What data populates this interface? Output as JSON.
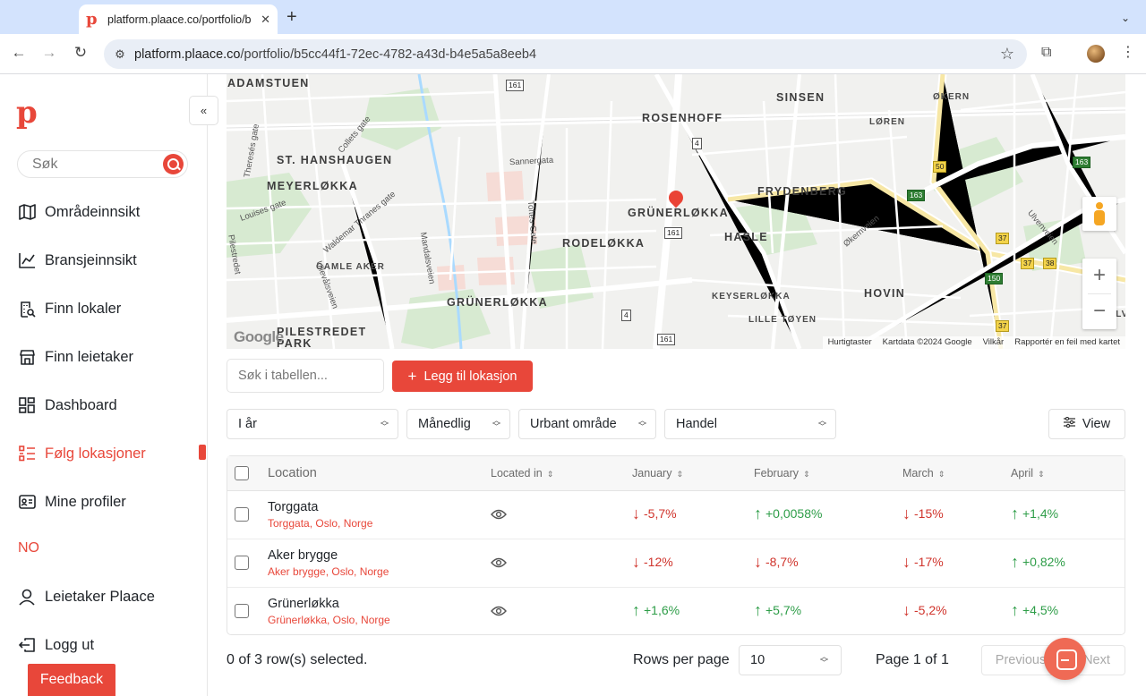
{
  "browser": {
    "tab_title": "platform.plaace.co/portfolio/b",
    "favicon": "p",
    "url_host": "platform.plaace.co",
    "url_path": "/portfolio/b5cc44f1-72ec-4782-a43d-b4e5a5a8eeb4"
  },
  "sidebar": {
    "logo": "p",
    "collapse_icon": "«",
    "search_placeholder": "Søk",
    "items": [
      {
        "label": "Områdeinnsikt",
        "icon": "map-icon"
      },
      {
        "label": "Bransjeinnsikt",
        "icon": "line-chart-icon"
      },
      {
        "label": "Finn lokaler",
        "icon": "building-search-icon"
      },
      {
        "label": "Finn leietaker",
        "icon": "store-icon"
      },
      {
        "label": "Dashboard",
        "icon": "dashboard-grid-icon"
      },
      {
        "label": "Følg lokasjoner",
        "icon": "list-icon",
        "active": true
      },
      {
        "label": "Mine profiler",
        "icon": "id-card-icon"
      }
    ],
    "language": "NO",
    "user_label": "Leietaker Plaace",
    "logout_label": "Logg ut",
    "feedback_label": "Feedback"
  },
  "map": {
    "areas": [
      "ADAMSTUEN",
      "ST. HANSHAUGEN",
      "MEYERLØKKA",
      "GAMLE AKER",
      "PILESTREDET PARK",
      "GRÜNERLØKKA",
      "RODELØKKA",
      "GRÜNERLØKKA",
      "ROSENHOFF",
      "SINSEN",
      "FRYDENBERG",
      "HASLE",
      "HOVIN",
      "LILLE TØYEN",
      "ØKERN",
      "LØREN",
      "KEYSERLØKKA",
      "ULV"
    ],
    "streets": [
      "Collets gate",
      "Theresés gate",
      "Louises gate",
      "Waldemar Thranes gate",
      "Sannergata",
      "Toftes Gate",
      "Mandalsveien",
      "Ullevålsveien",
      "Pilestredet",
      "Økernveien",
      "Ulvenveien"
    ],
    "route_shields": [
      "161",
      "4",
      "161",
      "4",
      "161",
      "50",
      "163",
      "163",
      "37",
      "37",
      "38",
      "150",
      "37"
    ],
    "attribution": [
      "Hurtigtaster",
      "Kartdata ©2024 Google",
      "Vilkår",
      "Rapportér en feil med kartet"
    ],
    "google_logo": "Google",
    "zoom_in": "+",
    "zoom_out": "−"
  },
  "controls": {
    "table_search_placeholder": "Søk i tabellen...",
    "add_button": "Legg til lokasjon",
    "filters": [
      "I år",
      "Månedlig",
      "Urbant område",
      "Handel"
    ],
    "view_button": "View"
  },
  "table": {
    "columns": [
      "Location",
      "Located in",
      "January",
      "February",
      "March",
      "April"
    ],
    "rows": [
      {
        "name": "Torggata",
        "address": "Torggata, Oslo, Norge",
        "values": [
          {
            "v": "-5,7%",
            "dir": "down"
          },
          {
            "v": "+0,0058%",
            "dir": "up"
          },
          {
            "v": "-15%",
            "dir": "down"
          },
          {
            "v": "+1,4%",
            "dir": "up"
          }
        ]
      },
      {
        "name": "Aker brygge",
        "address": "Aker brygge, Oslo, Norge",
        "values": [
          {
            "v": "-12%",
            "dir": "down"
          },
          {
            "v": "-8,7%",
            "dir": "down"
          },
          {
            "v": "-17%",
            "dir": "down"
          },
          {
            "v": "+0,82%",
            "dir": "up"
          }
        ]
      },
      {
        "name": "Grünerløkka",
        "address": "Grünerløkka, Oslo, Norge",
        "values": [
          {
            "v": "+1,6%",
            "dir": "up"
          },
          {
            "v": "+5,7%",
            "dir": "up"
          },
          {
            "v": "-5,2%",
            "dir": "down"
          },
          {
            "v": "+4,5%",
            "dir": "up"
          }
        ]
      }
    ]
  },
  "pagination": {
    "selected_text": "0 of 3 row(s) selected.",
    "rows_per_page_label": "Rows per page",
    "rows_per_page": "10",
    "page_text": "Page 1 of 1",
    "previous": "Previous",
    "next": "Next"
  },
  "colors": {
    "accent": "#e8473a",
    "up": "#2e9d48",
    "down": "#d0342c"
  }
}
